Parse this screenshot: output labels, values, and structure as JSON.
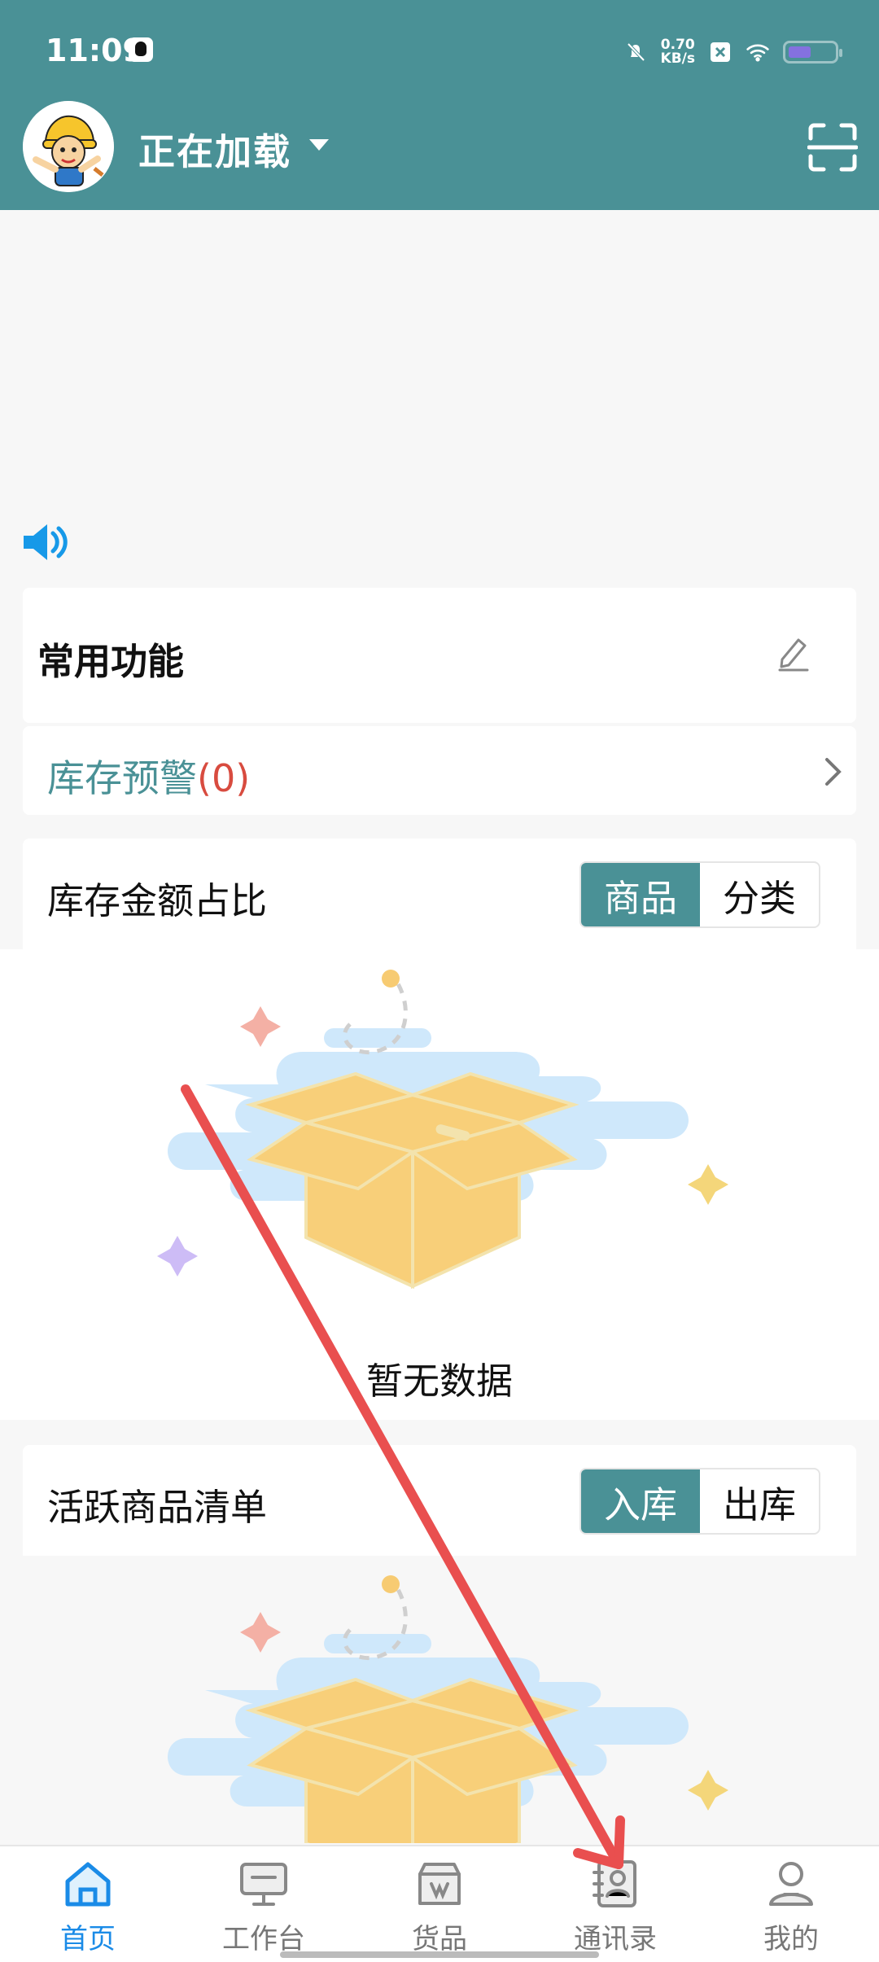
{
  "status": {
    "time": "11:09",
    "network_speed": "0.70",
    "network_unit": "KB/s"
  },
  "header": {
    "store_name": "正在加载",
    "avatar": "cartoon worker avatar"
  },
  "home": {
    "common_functions_title": "常用功能",
    "stock_warning_label": "库存预警",
    "stock_warning_count": "(0)",
    "stock_amount_title": "库存金额占比",
    "stock_tabs": [
      "商品",
      "分类"
    ],
    "empty_text": "暂无数据",
    "active_goods_title": "活跃商品清单",
    "active_tabs": [
      "入库",
      "出库"
    ]
  },
  "bottom_nav": {
    "items": [
      {
        "label": "首页",
        "icon": "home-icon"
      },
      {
        "label": "工作台",
        "icon": "desktop-icon"
      },
      {
        "label": "货品",
        "icon": "goods-icon"
      },
      {
        "label": "通讯录",
        "icon": "contacts-icon"
      },
      {
        "label": "我的",
        "icon": "profile-icon"
      }
    ]
  },
  "colors": {
    "primary": "#4a9196",
    "active_blue": "#1a8be7",
    "warning_red": "#d84b3f",
    "annotation_red": "#e94f4f"
  }
}
